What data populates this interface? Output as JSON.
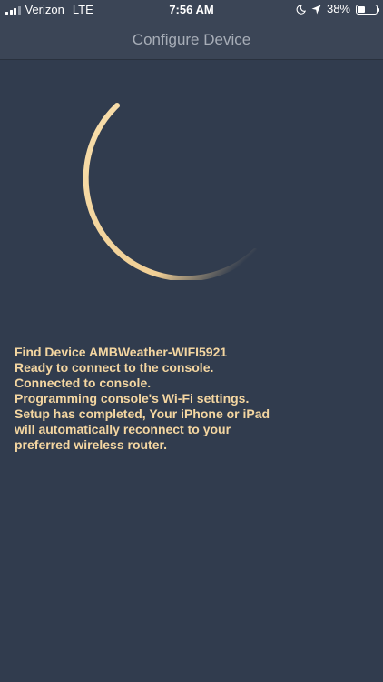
{
  "status_bar": {
    "carrier": "Verizon",
    "network": "LTE",
    "time": "7:56 AM",
    "battery_percent_text": "38%",
    "battery_level": 0.38,
    "icons": [
      "signal-bars-icon",
      "do-not-disturb-moon-icon",
      "location-arrow-icon",
      "battery-icon"
    ]
  },
  "nav": {
    "title": "Configure Device"
  },
  "spinner": {
    "icon": "loading-arc-spinner",
    "color": "#f4d6a1"
  },
  "messages": [
    "Find Device AMBWeather-WIFI5921",
    "Ready to connect to the console.",
    "Connected to console.",
    "Programming console's Wi-Fi settings.",
    "Setup has completed, Your iPhone or iPad\nwill automatically reconnect to your\npreferred wireless router."
  ],
  "colors": {
    "background": "#313c4e",
    "bar": "#3b4556",
    "title_text": "#a7adb7",
    "accent_text": "#f4d6a1"
  }
}
